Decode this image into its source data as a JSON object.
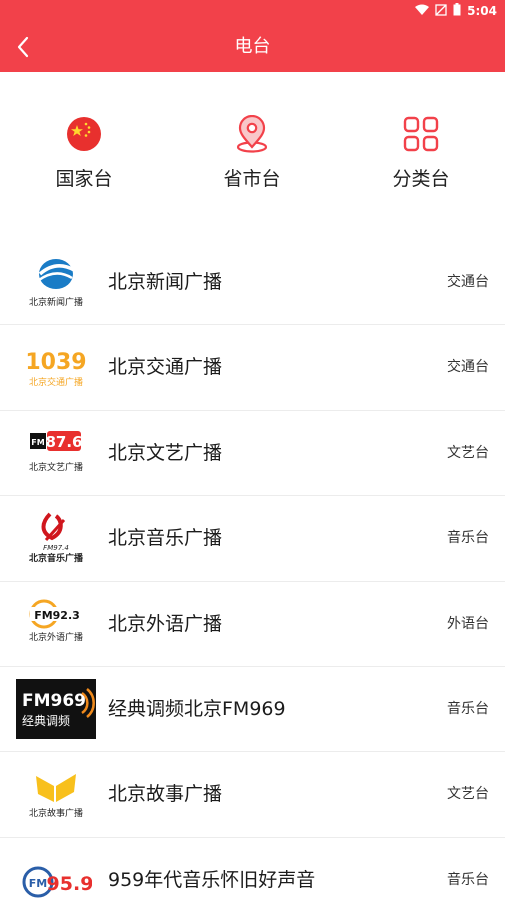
{
  "status_bar": {
    "time": "5:04"
  },
  "header": {
    "title": "电台"
  },
  "categories": [
    {
      "label": "国家台",
      "icon": "china-flag-icon"
    },
    {
      "label": "省市台",
      "icon": "location-pin-icon"
    },
    {
      "label": "分类台",
      "icon": "grid-icon"
    }
  ],
  "stations": [
    {
      "name": "北京新闻广播",
      "tag": "交通台",
      "logo_text": "北京新闻广播"
    },
    {
      "name": "北京交通广播",
      "tag": "交通台",
      "logo_text": "1039",
      "logo_sub": "北京交通广播"
    },
    {
      "name": "北京文艺广播",
      "tag": "文艺台",
      "logo_text": "87.6",
      "logo_sub": "北京文艺广播"
    },
    {
      "name": "北京音乐广播",
      "tag": "音乐台",
      "logo_text": "FM97.4",
      "logo_sub": "北京音乐广播"
    },
    {
      "name": "北京外语广播",
      "tag": "外语台",
      "logo_text": "FM92.3",
      "logo_sub": "北京外语广播"
    },
    {
      "name": "经典调频北京FM969",
      "tag": "音乐台",
      "logo_text": "FM969",
      "logo_sub": "经典调频"
    },
    {
      "name": "北京故事广播",
      "tag": "文艺台",
      "logo_text": "北京故事广播"
    },
    {
      "name": "959年代音乐怀旧好声音",
      "tag": "音乐台",
      "logo_text": "95.9"
    }
  ],
  "colors": {
    "brand_red": "#f2414a",
    "divider": "#ececec"
  }
}
